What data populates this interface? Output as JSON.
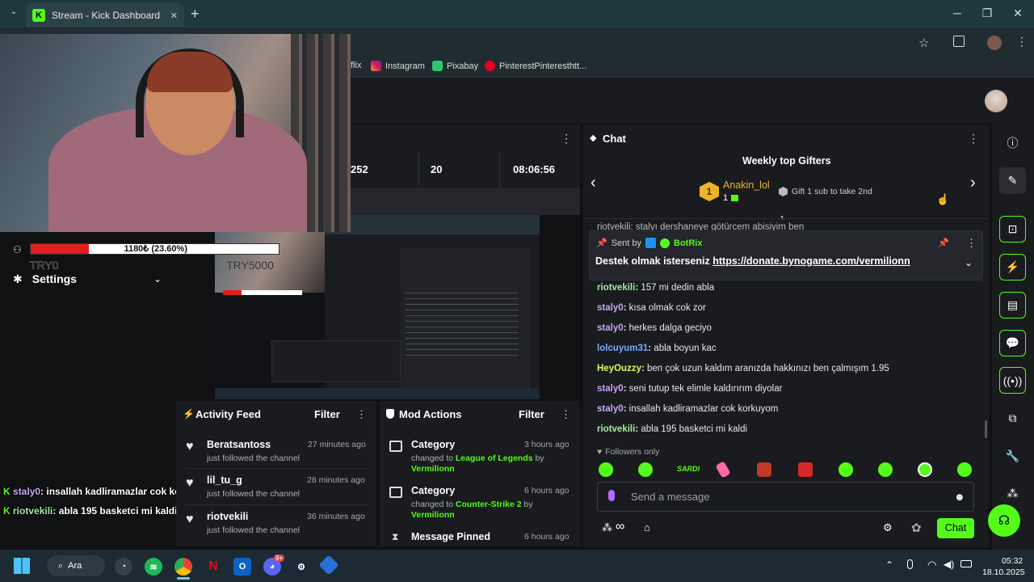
{
  "browser": {
    "tab_title": "Stream - Kick Dashboard",
    "tab_close": "✕",
    "new_tab": "+",
    "bookmarks": [
      {
        "label": "flix",
        "icon": "netflix-icon"
      },
      {
        "label": "Instagram",
        "icon": "instagram-icon"
      },
      {
        "label": "Pixabay",
        "icon": "pixabay-icon"
      },
      {
        "label": "PinterestPinteresthtt...",
        "icon": "pinterest-icon"
      }
    ]
  },
  "stats": {
    "values": [
      "252",
      "20",
      "08:06:56"
    ]
  },
  "overlay": {
    "progress_text": "1180₺ (23.60%)",
    "progress_fraction": 0.236,
    "label_left": "TRY0",
    "label_right": "TRY5000",
    "settings_label": "Settings"
  },
  "chat": {
    "title": "Chat",
    "gifters_title": "Weekly top Gifters",
    "top_gifter": "Anakin_lol",
    "top_gifter_count": "1",
    "gift_hint": "Gift 1 sub to take 2nd",
    "partial_line": "riotvekili: stalyı dershaneye götürcem abisiyim ben",
    "pinned_prefix": "Sent by",
    "pinned_bot": "BotRix",
    "pinned_text": "Destek olmak isterseniz",
    "pinned_link": "https://donate.bynogame.com/vermilionn",
    "messages": [
      {
        "user": "riotvekili",
        "text": "157 mi dedin abla",
        "color": "#a5e8a0"
      },
      {
        "user": "staly0",
        "text": "kısa olmak cok zor",
        "color": "#c9a8f0"
      },
      {
        "user": "staly0",
        "text": "herkes dalga geciyo",
        "color": "#c9a8f0"
      },
      {
        "user": "lolcuyum31",
        "text": "abla boyun kac",
        "color": "#7aa9ff"
      },
      {
        "user": "HeyOuzzy",
        "text": "ben çok uzun kaldım aranızda hakkınızı ben çalmışım 1.95",
        "color": "#d7ff5a"
      },
      {
        "user": "staly0",
        "text": "seni tutup tek elimle kaldırırım diyolar",
        "color": "#c9a8f0"
      },
      {
        "user": "staly0",
        "text": "insallah kadliramazlar cok korkuyom",
        "color": "#c9a8f0"
      },
      {
        "user": "riotvekili",
        "text": "abla 195 basketci mi kaldi",
        "color": "#a5e8a0"
      }
    ],
    "followers_only": "Followers only",
    "emote_sardi": "SARDI",
    "input_placeholder": "Send a message",
    "send_button": "Chat"
  },
  "activity": {
    "title": "Activity Feed",
    "filter": "Filter",
    "items": [
      {
        "user": "Beratsantoss",
        "sub": "just followed the channel",
        "time": "27 minutes ago"
      },
      {
        "user": "lil_tu_g",
        "sub": "just followed the channel",
        "time": "28 minutes ago"
      },
      {
        "user": "riotvekili",
        "sub": "just followed the channel",
        "time": "36 minutes ago"
      }
    ]
  },
  "mod": {
    "title": "Mod Actions",
    "filter": "Filter",
    "items": [
      {
        "title": "Category",
        "time": "3 hours ago",
        "changed": "changed to",
        "target": "League of Legends",
        "by": "by",
        "user": "Vermilionn"
      },
      {
        "title": "Category",
        "time": "6 hours ago",
        "changed": "changed to",
        "target": "Counter-Strike 2",
        "by": "by",
        "user": "Vermilionn"
      },
      {
        "title": "Message Pinned",
        "time": "6 hours ago"
      }
    ]
  },
  "overlay_chat": [
    {
      "user": "staly0",
      "text": ": insallah kadliramazlar cok korkuyom",
      "color": "#c9a8f0"
    },
    {
      "user": "riotvekili",
      "text": ": abla 195 basketci mi kaldi",
      "color": "#a5e8a0"
    }
  ],
  "taskbar": {
    "search": "Ara",
    "time": "05:32",
    "date": "18.10.2025",
    "discord_badge": "9+"
  },
  "colors": {
    "kick_green": "#53fc18",
    "progress_red": "#e11d1d"
  }
}
